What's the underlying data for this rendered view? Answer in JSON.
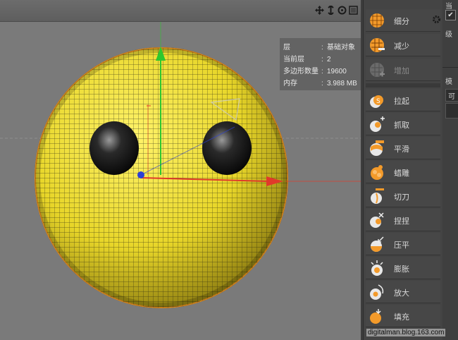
{
  "viewport": {
    "info": [
      {
        "key": "层",
        "value": "基础对象"
      },
      {
        "key": "当前层",
        "value": "2"
      },
      {
        "key": "多边形数量",
        "value": "19600"
      },
      {
        "key": "内存",
        "value": "3.988 MB"
      }
    ]
  },
  "tools": {
    "subdivide": "细分",
    "reduce": "减少",
    "increase": "增加",
    "pull": "拉起",
    "grab": "抓取",
    "smooth": "平滑",
    "wax": "蜡雕",
    "flatten": "切刀",
    "pinch": "捏捏",
    "press": "压平",
    "inflate": "膨胀",
    "amplify": "放大",
    "fill": "填充"
  },
  "right_panel": {
    "top_text": "当",
    "level_label": "级",
    "mode_label": "模",
    "visible_label": "可"
  },
  "watermark": "digitalman.blog.163.com",
  "colors": {
    "sphere": "#f2e23a",
    "wire": "#1e1e10",
    "axis_x": "#e03a2a",
    "axis_y": "#2ec82e",
    "axis_z": "#2b3fd6",
    "tool_orange": "#f39a2a"
  }
}
